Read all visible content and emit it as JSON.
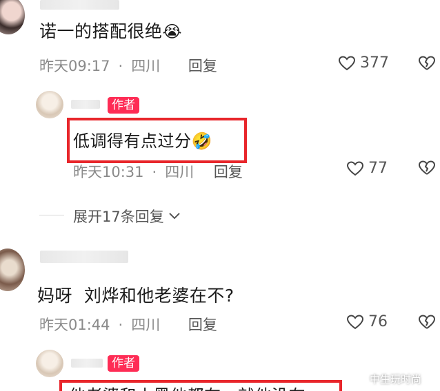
{
  "comments": [
    {
      "text": "诺一的搭配很绝",
      "emoji": "😭",
      "time": "昨天09:17",
      "location": "四川",
      "reply_label": "回复",
      "likes": "377",
      "reply": {
        "badge": "作者",
        "text": "低调得有点过分",
        "emoji": "🤣",
        "time": "昨天10:31",
        "location": "四川",
        "reply_label": "回复",
        "likes": "77",
        "expand_label": "展开17条回复"
      }
    },
    {
      "text": "妈呀  刘烨和他老婆在不?",
      "time": "昨天01:44",
      "location": "四川",
      "reply_label": "回复",
      "likes": "76",
      "reply": {
        "badge": "作者",
        "text_partial": "他老婆和小黑他都在，就他没在"
      }
    }
  ],
  "separator": "·",
  "watermark": "中生玩时尚",
  "colors": {
    "badge": "#fe2c55",
    "highlight": "#e8262b",
    "meta": "#8a8a8a"
  }
}
